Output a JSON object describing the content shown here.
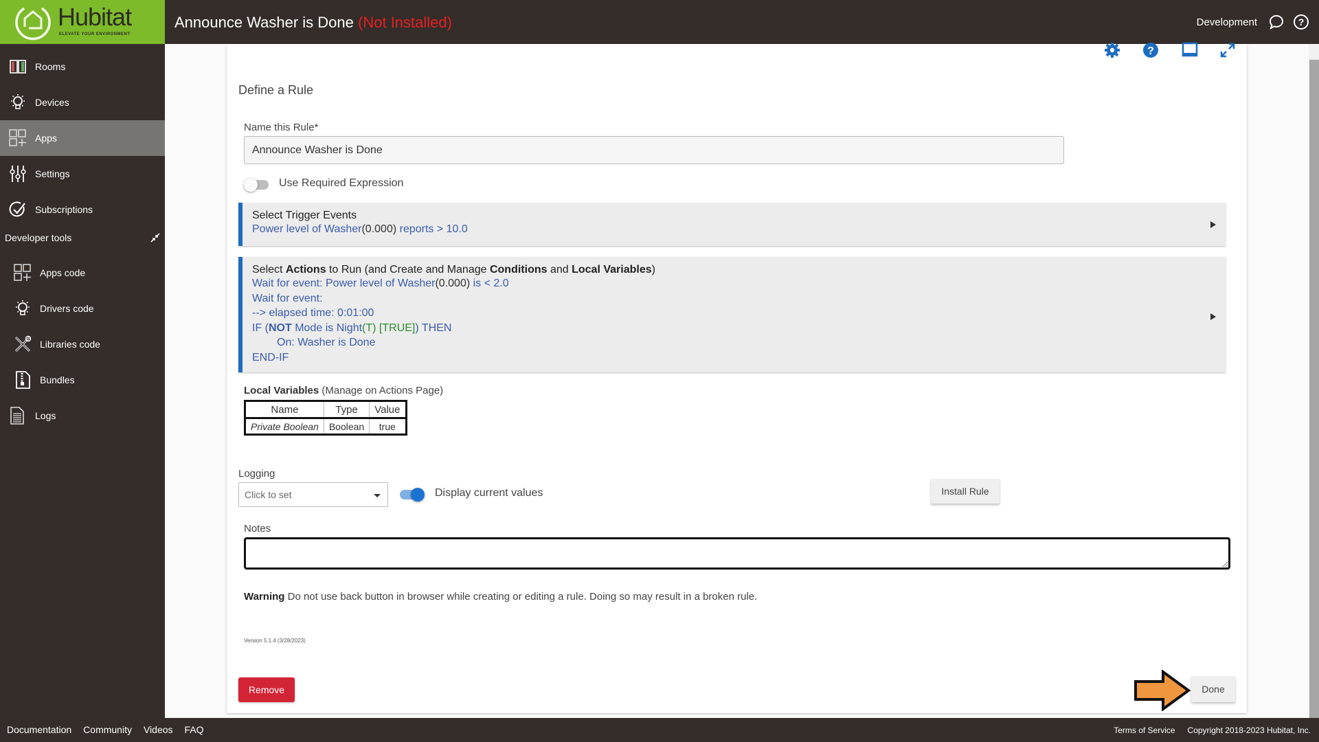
{
  "header": {
    "brand": "Hubitat",
    "tagline": "ELEVATE YOUR ENVIRONMENT",
    "title": "Announce Washer is Done",
    "status": "(Not Installed)",
    "status_color": "#e52020",
    "hub_name": "Development",
    "icons": [
      "chat-icon",
      "help-icon"
    ]
  },
  "sidebar": {
    "items": [
      {
        "label": "Rooms",
        "icon": "rooms-icon"
      },
      {
        "label": "Devices",
        "icon": "bulb-icon"
      },
      {
        "label": "Apps",
        "icon": "apps-icon",
        "active": true
      },
      {
        "label": "Settings",
        "icon": "sliders-icon"
      },
      {
        "label": "Subscriptions",
        "icon": "check-circle-icon"
      }
    ],
    "dev_section": "Developer tools",
    "dev_items": [
      {
        "label": "Apps code",
        "icon": "apps-icon"
      },
      {
        "label": "Drivers code",
        "icon": "bulb-icon"
      },
      {
        "label": "Libraries code",
        "icon": "tools-icon"
      },
      {
        "label": "Bundles",
        "icon": "zip-file-icon"
      },
      {
        "label": "Logs",
        "icon": "document-icon"
      }
    ]
  },
  "toolbar": {
    "icons": [
      "gear-icon",
      "help-icon",
      "window-icon",
      "expand-icon"
    ]
  },
  "form": {
    "section_title": "Define a Rule",
    "name_label": "Name this Rule*",
    "name_value": "Announce Washer is Done",
    "required_expr_label": "Use Required Expression",
    "required_expr_on": false,
    "trigger": {
      "title": "Select Trigger Events",
      "line_pre": "Power level of Washer",
      "line_val": "(0.000)",
      "line_post": " reports > 10.0"
    },
    "actions": {
      "t1": "Select ",
      "t2": "Actions",
      "t3": " to Run (and Create and Manage ",
      "t4": "Conditions",
      "t5": " and ",
      "t6": "Local Variables",
      "t7": ")",
      "l1_pre": "Wait for event: Power level of Washer",
      "l1_val": "(0.000)",
      "l1_post": " is < 2.0",
      "l2": "Wait for event:",
      "l3": " --> elapsed time: 0:01:00",
      "l4_a": "IF (",
      "l4_b": "NOT",
      "l4_c": " Mode is Night",
      "l4_d": "(T) [TRUE]",
      "l4_e": ") THEN",
      "l5": "On: Washer is Done",
      "l6": "END-IF"
    },
    "local_vars": {
      "title": "Local Variables",
      "subtitle": " (Manage on Actions Page)",
      "columns": [
        "Name",
        "Type",
        "Value"
      ],
      "rows": [
        [
          "Private Boolean",
          "Boolean",
          "true"
        ]
      ]
    },
    "logging_label": "Logging",
    "logging_placeholder": "Click to set",
    "display_values_label": "Display current values",
    "display_values_on": true,
    "install_label": "Install Rule",
    "notes_label": "Notes",
    "notes_value": "",
    "warning_bold": "Warning",
    "warning_text": " Do not use back button in browser while creating or editing a rule. Doing so may result in a broken rule.",
    "version": "Version 5.1.4 (3/28/2023)",
    "remove_label": "Remove",
    "done_label": "Done"
  },
  "footer": {
    "links": [
      "Documentation",
      "Community",
      "Videos",
      "FAQ"
    ],
    "terms": "Terms of Service",
    "copyright": "Copyright 2018-2023 Hubitat, Inc."
  }
}
